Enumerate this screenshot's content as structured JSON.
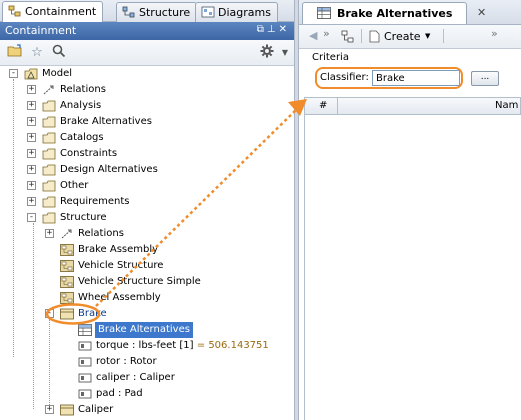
{
  "tabs": {
    "containment": "Containment",
    "structure": "Structure",
    "diagrams": "Diagrams"
  },
  "panel_title": "Containment",
  "tree": {
    "model": "Model",
    "relations": "Relations",
    "analysis": "Analysis",
    "brake_alternatives_pkg": "Brake Alternatives",
    "catalogs": "Catalogs",
    "constraints": "Constraints",
    "design_alternatives": "Design Alternatives",
    "other": "Other",
    "requirements": "Requirements",
    "structure": "Structure",
    "structure_relations": "Relations",
    "brake_assembly": "Brake Assembly",
    "vehicle_structure": "Vehicle Structure",
    "vehicle_structure_simple": "Vehicle Structure Simple",
    "wheel_assembly": "Wheel Assembly",
    "brake": "Brake",
    "brake_alternatives_table": "Brake Alternatives",
    "torque_name": "torque : lbs-feet [1]",
    "torque_value": "= 506.143751",
    "rotor": "rotor : Rotor",
    "caliper_prop": "caliper : Caliper",
    "pad": "pad : Pad",
    "caliper": "Caliper"
  },
  "right": {
    "tab_title": "Brake Alternatives",
    "create_label": "Create",
    "criteria_label": "Criteria",
    "classifier_label": "Classifier:",
    "classifier_value": "Brake",
    "more_button": "...",
    "col_number": "#",
    "col_name": "Nam"
  },
  "colors": {
    "highlight": "#f08c2b",
    "selection": "#3d78cc"
  }
}
